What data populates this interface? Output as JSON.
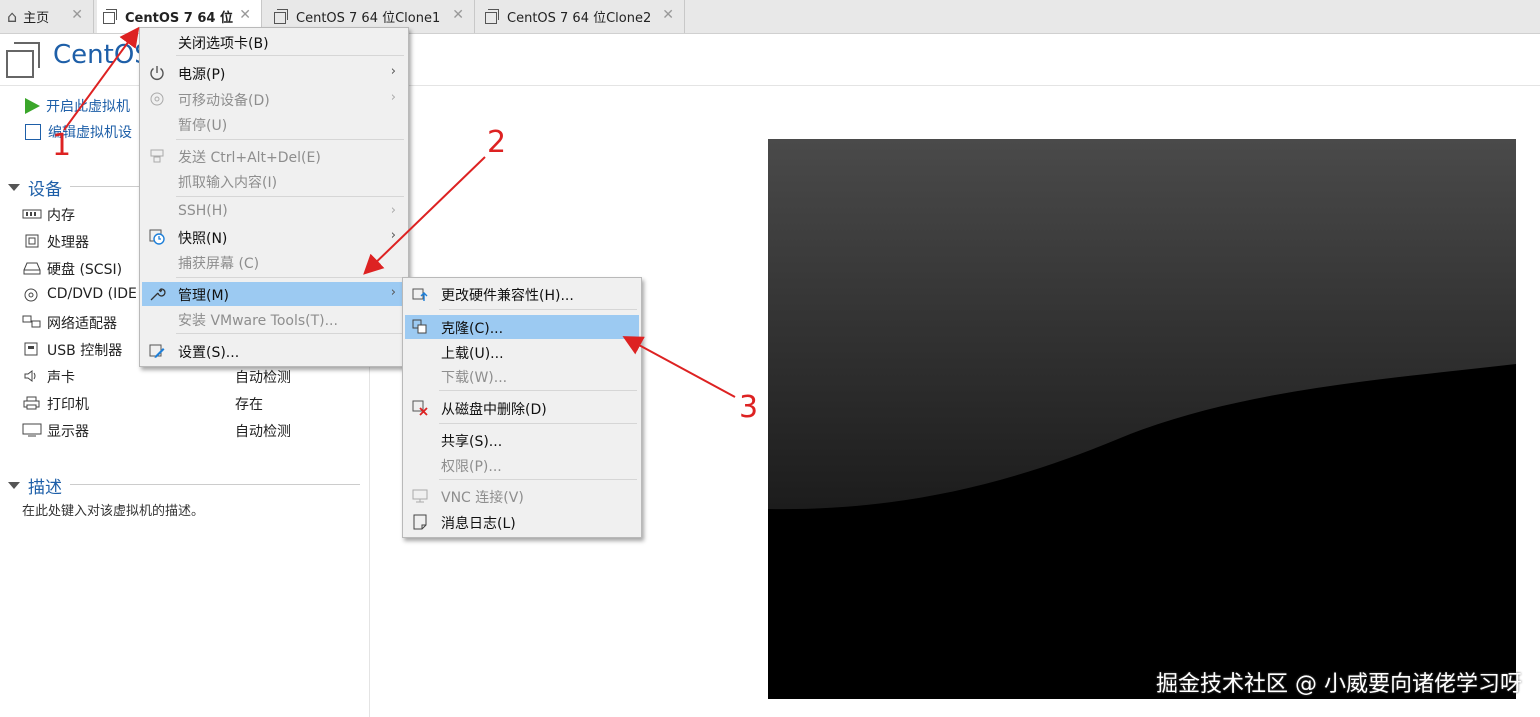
{
  "tabs": [
    {
      "label": "主页",
      "icon": "home-icon",
      "active": false
    },
    {
      "label": "CentOS 7 64 位",
      "icon": "vm-icon",
      "active": true
    },
    {
      "label": "CentOS 7 64 位Clone1",
      "icon": "vm-clone-icon",
      "active": false
    },
    {
      "label": "CentOS 7 64 位Clone2",
      "icon": "vm-clone-icon",
      "active": false
    }
  ],
  "header": {
    "title": "CentOS"
  },
  "actions": [
    {
      "label": "开启此虚拟机",
      "icon": "play-icon"
    },
    {
      "label": "编辑虚拟机设",
      "icon": "edit-icon"
    }
  ],
  "devices": {
    "title": "设备",
    "items": [
      {
        "name": "内存",
        "value": "",
        "icon": "memory-icon"
      },
      {
        "name": "处理器",
        "value": "",
        "icon": "cpu-icon"
      },
      {
        "name": "硬盘 (SCSI)",
        "value": "",
        "icon": "disk-icon"
      },
      {
        "name": "CD/DVD (IDE",
        "value": "",
        "icon": "cd-icon"
      },
      {
        "name": "网络适配器",
        "value": "",
        "icon": "network-icon"
      },
      {
        "name": "USB 控制器",
        "value": "",
        "icon": "usb-icon"
      },
      {
        "name": "声卡",
        "value": "自动检测",
        "icon": "sound-icon"
      },
      {
        "name": "打印机",
        "value": "存在",
        "icon": "printer-icon"
      },
      {
        "name": "显示器",
        "value": "自动检测",
        "icon": "monitor-icon"
      }
    ]
  },
  "description": {
    "title": "描述",
    "placeholder": "在此处键入对该虚拟机的描述。"
  },
  "context_menu": {
    "items": [
      {
        "label": "关闭选项卡(B)",
        "enabled": true,
        "submenu": false,
        "icon": ""
      },
      {
        "label": "电源(P)",
        "enabled": true,
        "submenu": true,
        "icon": "power-icon"
      },
      {
        "label": "可移动设备(D)",
        "enabled": false,
        "submenu": true,
        "icon": "removable-device-icon"
      },
      {
        "label": "暂停(U)",
        "enabled": false,
        "submenu": false,
        "icon": ""
      },
      {
        "label": "发送 Ctrl+Alt+Del(E)",
        "enabled": false,
        "submenu": false,
        "icon": "keyboard-send-icon"
      },
      {
        "label": "抓取输入内容(I)",
        "enabled": false,
        "submenu": false,
        "icon": ""
      },
      {
        "label": "SSH(H)",
        "enabled": false,
        "submenu": true,
        "icon": ""
      },
      {
        "label": "快照(N)",
        "enabled": true,
        "submenu": true,
        "icon": "snapshot-icon"
      },
      {
        "label": "捕获屏幕 (C)",
        "enabled": false,
        "submenu": false,
        "icon": ""
      },
      {
        "label": "管理(M)",
        "enabled": true,
        "submenu": true,
        "icon": "wrench-icon",
        "highlighted": true
      },
      {
        "label": "安装 VMware Tools(T)...",
        "enabled": false,
        "submenu": false,
        "icon": ""
      },
      {
        "label": "设置(S)...",
        "enabled": true,
        "submenu": false,
        "icon": "settings-icon"
      }
    ]
  },
  "manage_submenu": {
    "items": [
      {
        "label": "更改硬件兼容性(H)...",
        "enabled": true,
        "icon": "upgrade-icon"
      },
      {
        "label": "克隆(C)...",
        "enabled": true,
        "icon": "clone-icon",
        "highlighted": true
      },
      {
        "label": "上载(U)...",
        "enabled": true,
        "icon": ""
      },
      {
        "label": "下载(W)...",
        "enabled": false,
        "icon": ""
      },
      {
        "label": "从磁盘中删除(D)",
        "enabled": true,
        "icon": "delete-from-disk-icon"
      },
      {
        "label": "共享(S)...",
        "enabled": true,
        "icon": ""
      },
      {
        "label": "权限(P)...",
        "enabled": false,
        "icon": ""
      },
      {
        "label": "VNC 连接(V)",
        "enabled": false,
        "icon": "vnc-icon"
      },
      {
        "label": "消息日志(L)",
        "enabled": true,
        "icon": "message-log-icon"
      }
    ]
  },
  "annotations": {
    "step1": "1",
    "step2": "2",
    "step3": "3",
    "color": "#d22222"
  },
  "watermark": "掘金技术社区 @ 小威要向诸佬学习呀"
}
